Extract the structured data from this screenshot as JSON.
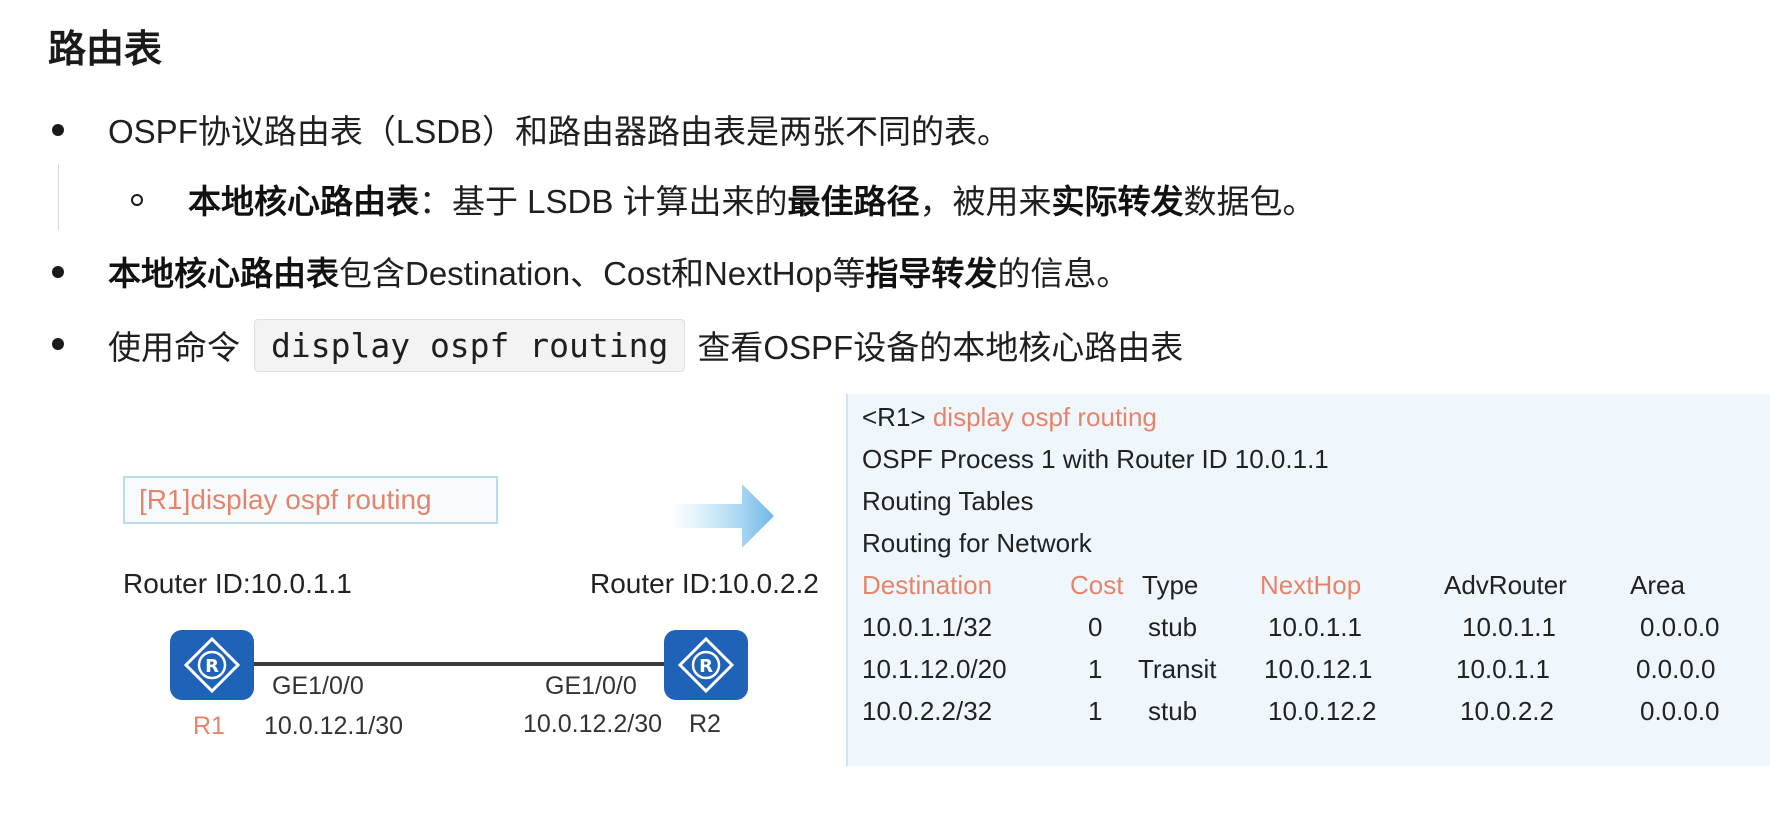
{
  "heading": "路由表",
  "bullets": {
    "b1": "OSPF协议路由表（LSDB）和路由器路由表是两张不同的表。",
    "sub1": {
      "bold1": "本地核心路由表",
      "t1": "：基于 LSDB 计算出来的",
      "bold2": "最佳路径",
      "t2": "，被用来",
      "bold3": "实际转发",
      "t3": "数据包。"
    },
    "b2": {
      "bold1": "本地核心路由表",
      "t1": "包含Destination、Cost和NextHop等",
      "bold2": "指导转发",
      "t2": "的信息。"
    },
    "b3": {
      "t1": "使用命令",
      "code": "display ospf routing",
      "t2": "查看OSPF设备的本地核心路由表"
    }
  },
  "diagram": {
    "command": "[R1]display ospf routing",
    "r1_router_id": "Router ID:10.0.1.1",
    "r2_router_id": "Router ID:10.0.2.2",
    "r1_if": "GE1/0/0",
    "r2_if": "GE1/0/0",
    "r1_name": "R1",
    "r1_ip": "10.0.12.1/30",
    "r2_ip": "10.0.12.2/30",
    "r2_name": "R2"
  },
  "terminal": {
    "prompt": "<R1>",
    "command": "display ospf routing",
    "line1": "OSPF Process 1 with Router ID 10.0.1.1",
    "line2": "Routing Tables",
    "line3": "Routing for Network",
    "headers": [
      "Destination",
      "Cost",
      "Type",
      "NextHop",
      "AdvRouter",
      "Area"
    ],
    "rows": [
      [
        "10.0.1.1/32",
        "0",
        "stub",
        "10.0.1.1",
        "10.0.1.1",
        "0.0.0.0"
      ],
      [
        "10.1.12.0/20",
        "1",
        "Transit",
        "10.0.12.1",
        "10.0.1.1",
        "0.0.0.0"
      ],
      [
        "10.0.2.2/32",
        "1",
        "stub",
        "10.0.12.2",
        "10.0.2.2",
        "0.0.0.0"
      ]
    ]
  },
  "colors": {
    "accent_red": "#e6846b",
    "router_blue": "#1f63b8",
    "panel_bg": "#f0f7fc"
  }
}
